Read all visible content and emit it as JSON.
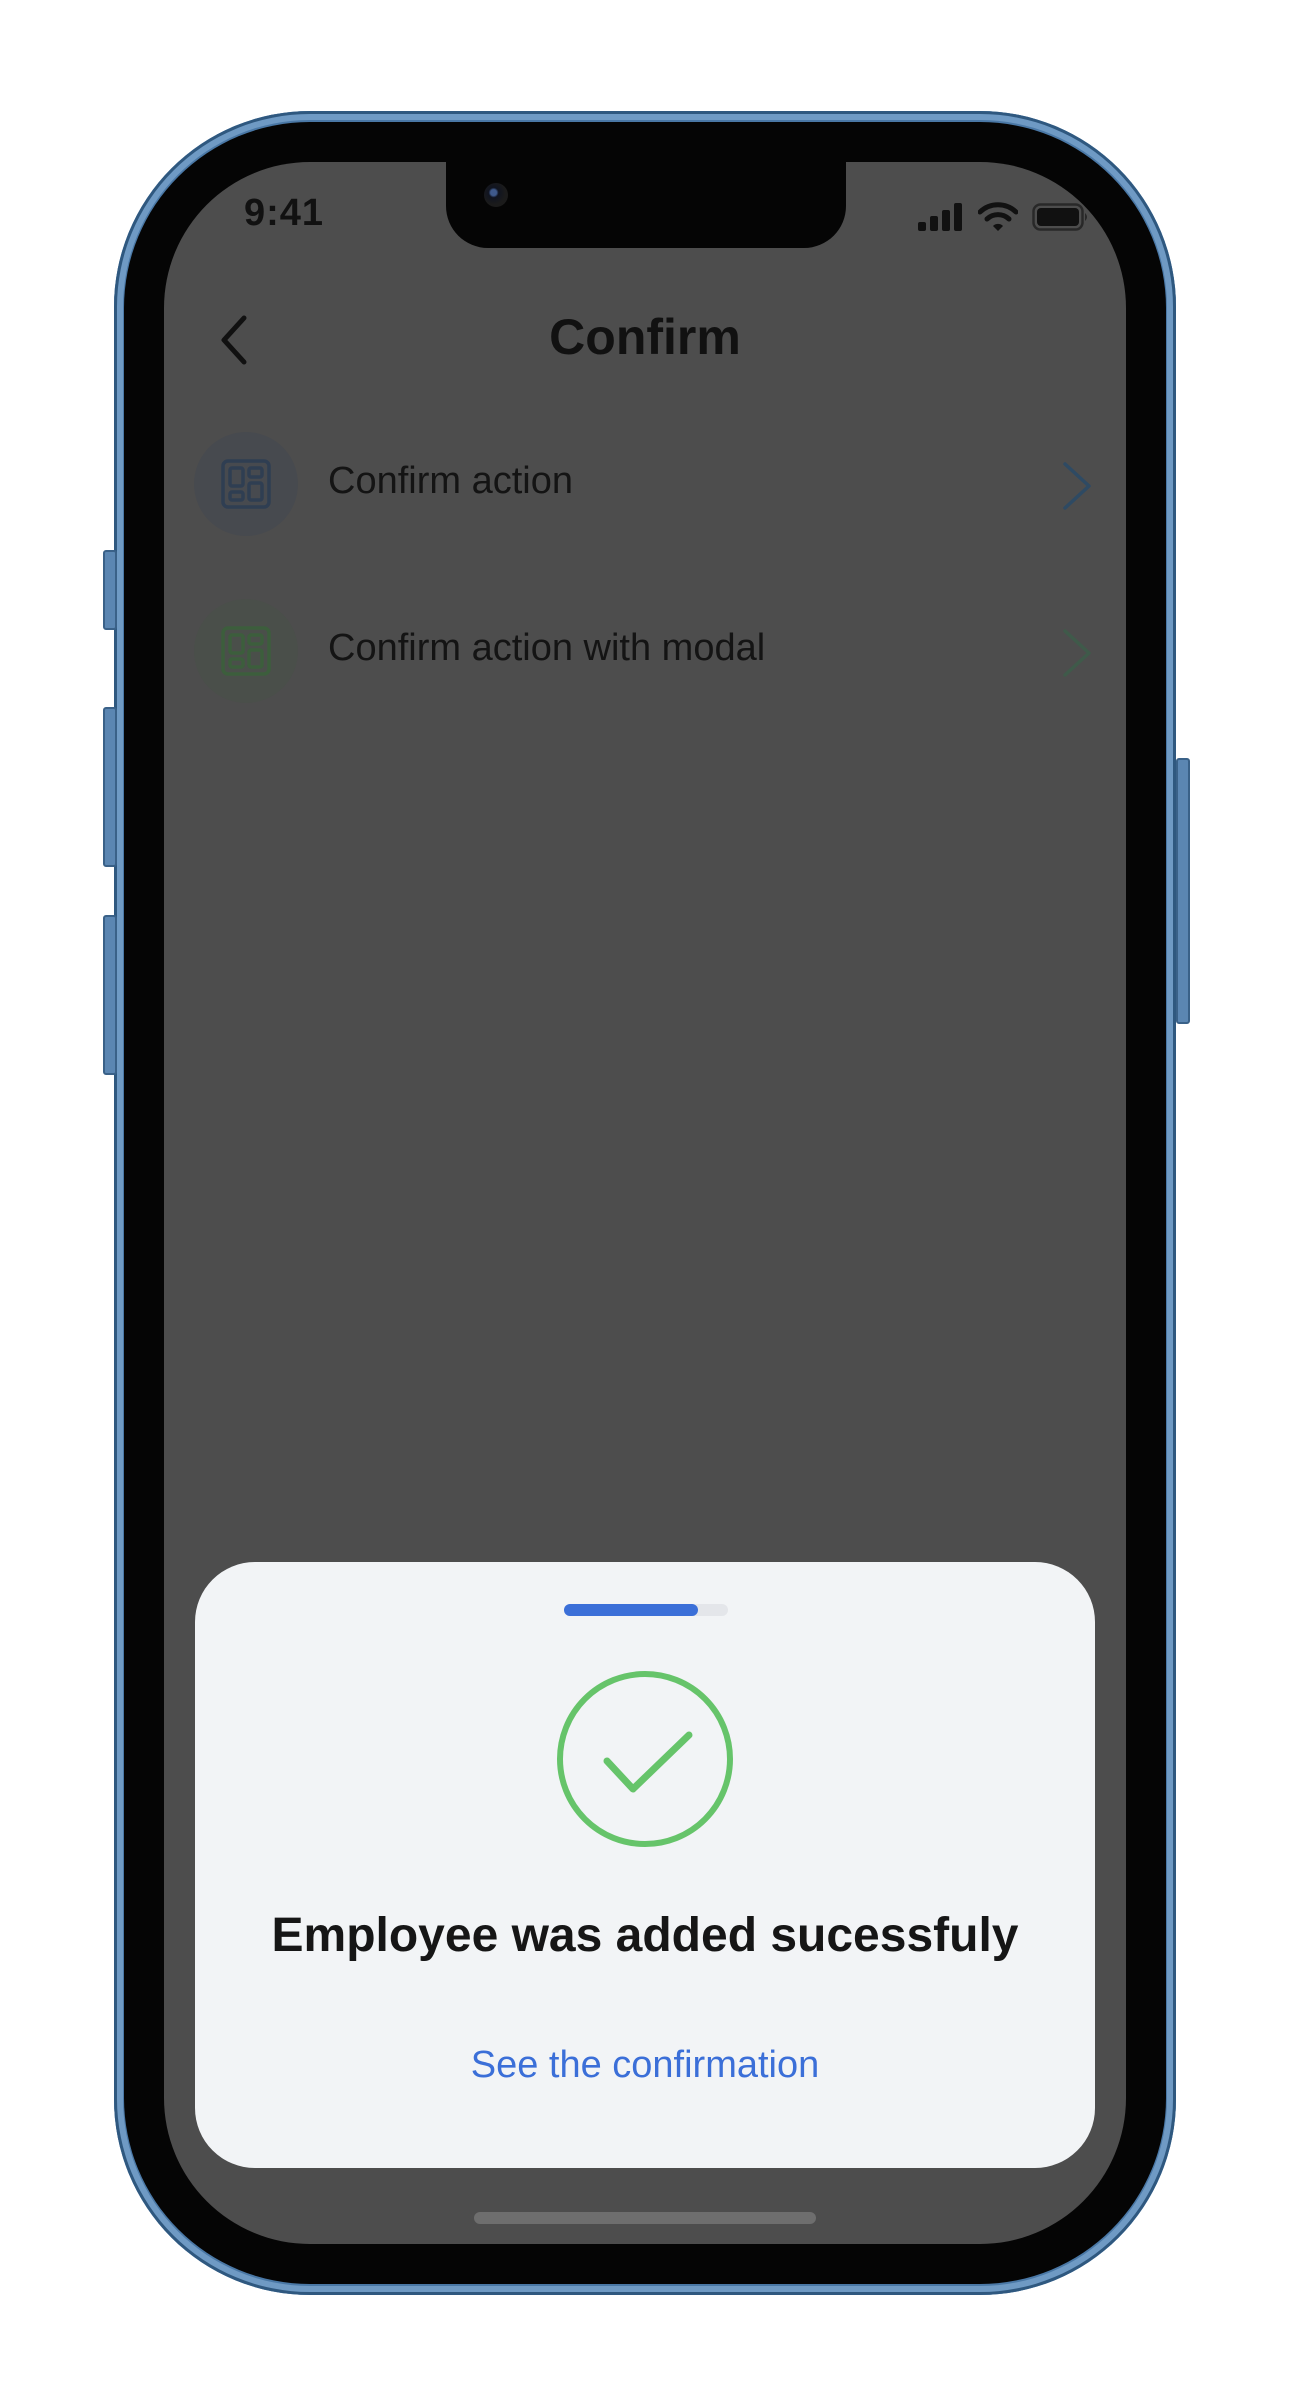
{
  "status_bar": {
    "time": "9:41"
  },
  "nav": {
    "title": "Confirm"
  },
  "list": {
    "items": [
      {
        "label": "Confirm action",
        "icon": "layout-grid-icon",
        "icon_color": "#2f3e52",
        "icon_bg": "#474a4f"
      },
      {
        "label": "Confirm action with modal",
        "icon": "layout-grid-icon",
        "icon_color": "#3c5e3c",
        "icon_bg": "#4a4f4a"
      }
    ]
  },
  "sheet": {
    "progress": 0.82,
    "icon": "check-circle-icon",
    "title": "Employee was added sucessfuly",
    "link_label": "See the confirmation"
  },
  "colors": {
    "accent": "#3b6fd8",
    "success": "#66c46a",
    "overlay_background": "#4d4d4d",
    "sheet_background": "#f2f4f6",
    "device_frame": "#4a78a6"
  }
}
